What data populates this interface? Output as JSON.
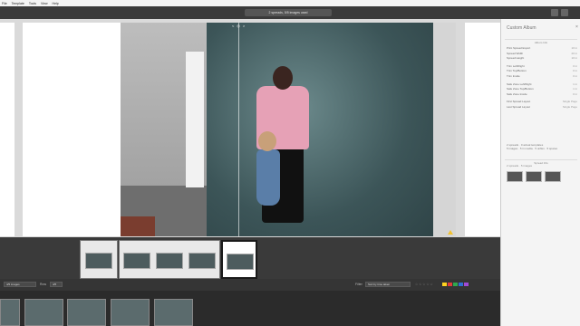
{
  "menu": [
    "File",
    "Template",
    "Tools",
    "View",
    "Help"
  ],
  "window_title": "2 spreads, 5/5 images used",
  "photo_toolbar": [
    "<",
    "◎",
    ">"
  ],
  "right_panel": {
    "title": "Custom Album",
    "close": "×",
    "section_album": "Album Info",
    "album_rows": [
      {
        "label": "Print Spread Export",
        "value": "10 in"
      },
      {
        "label": "Spread Width",
        "value": "20 in"
      },
      {
        "label": "Spread Height",
        "value": "10 in"
      }
    ],
    "trim_rows": [
      {
        "label": "Trim Left/Right",
        "value": "0 in"
      },
      {
        "label": "Trim Top/Bottom",
        "value": "0 in"
      },
      {
        "label": "Trim Inside",
        "value": "0 in"
      }
    ],
    "safe_rows": [
      {
        "label": "Safe Zone Left/Right",
        "value": "1 in"
      },
      {
        "label": "Safe Zone Top/Bottom",
        "value": "1 in"
      },
      {
        "label": "Safe Zone Inside",
        "value": "0 in"
      }
    ],
    "layout_rows": [
      {
        "label": "First Spread Layout",
        "value": "Single Page"
      },
      {
        "label": "Last Spread Layout",
        "value": "Single Page"
      }
    ],
    "note_line1": "2 spreads · 0 actual templates",
    "note_line2": "5 images · 5 in media · 5 unflex · 5 spares",
    "section_spreads": "Spread Info",
    "spreads_caption": "2 spreads · 5 images"
  },
  "bottom": {
    "layout_select": "4/5 images",
    "row_label": "Row",
    "row_value": "4/5",
    "filter_label": "Filter",
    "sort_select": "Sort by time taken",
    "stars": "☆ ☆ ☆ ☆ ☆",
    "colors": [
      "#ffd21f",
      "#e23b3b",
      "#2fa84f",
      "#2f6fd6",
      "#a04ad6"
    ]
  }
}
